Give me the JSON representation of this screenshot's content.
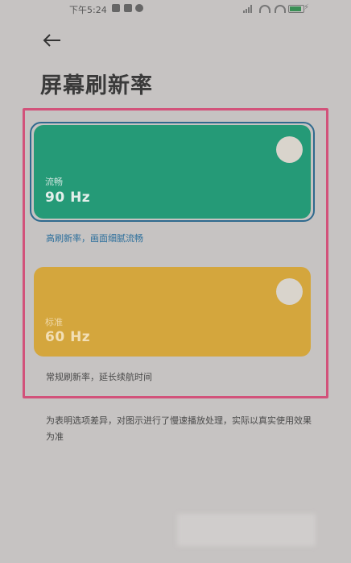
{
  "status_bar": {
    "time": "下午5:24",
    "app_icons": [
      "app-icon",
      "app-icon",
      "app-icon"
    ],
    "charging_symbol": "⚡"
  },
  "nav": {
    "back_glyph": "←"
  },
  "page": {
    "title": "屏幕刷新率"
  },
  "options": [
    {
      "name": "流畅",
      "rate": "90 Hz",
      "description": "高刷新率，画面细腻流畅",
      "selected": true,
      "color": "#259a77"
    },
    {
      "name": "标准",
      "rate": "60 Hz",
      "description": "常规刷新率，延长续航时间",
      "selected": false,
      "color": "#d4a63d"
    }
  ],
  "footnote": "为表明选项差异，对图示进行了慢速播放处理，实际以真实使用效果为准",
  "colors": {
    "highlight_frame": "#d2527a",
    "selected_ring": "#2f6a8e",
    "selected_desc": "#2c6f9c"
  }
}
